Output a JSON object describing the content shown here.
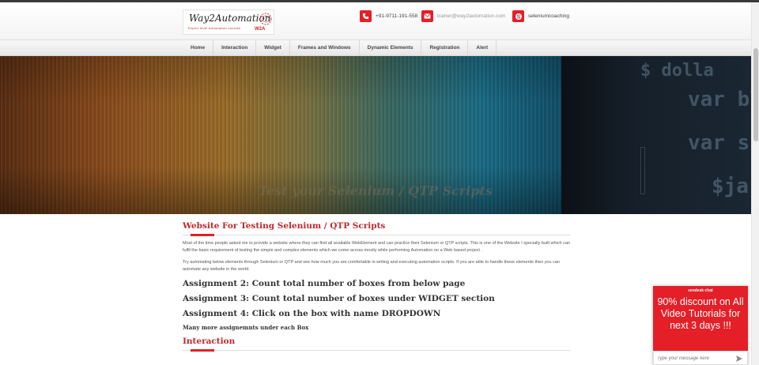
{
  "header": {
    "logo": {
      "name": "Way2Automation",
      "tagline": "Expert level Automation courses",
      "mark": "W2A"
    },
    "contacts": [
      {
        "icon": "phone-icon",
        "text": "+91-9711-191-558"
      },
      {
        "icon": "email-icon",
        "text": "trainer@way2automation.com"
      },
      {
        "icon": "skype-icon",
        "text": "seleniumcoaching"
      }
    ]
  },
  "nav": {
    "items": [
      "Home",
      "Interaction",
      "Widget",
      "Frames and Windows",
      "Dynamic Elements",
      "Registration",
      "Alert"
    ]
  },
  "hero": {
    "caption": "Test your Selenium / QTP Scripts",
    "code": [
      "$ dolla",
      "var bl",
      "var s",
      "$ja"
    ]
  },
  "main": {
    "heading": "Website For Testing Selenium / QTP Scripts",
    "paragraph1": "Most of the time people asked me to provide a website where they can find all available WebElement and can practice their Selenium or QTP scripts. This is one of the Website I specially built which can fulfil the basic requirement of testing the simple and complex elements which we come across mostly while performing Automation on a Web based project .",
    "paragraph2": "Try automating below elements through Selenium or QTP and see how much you are comfortable in writing and executing automation scripts. If you are able to handle these elements then you can automate any website in the world.",
    "assignments": [
      "Assignment 2: Count total number of boxes from below page",
      "Assignment 3: Count total number of boxes under WIDGET section",
      "Assignment 4: Click on the box with name DROPDOWN"
    ],
    "more": "Many more assignemnts under each Box",
    "section2": "Interaction"
  },
  "chat": {
    "header": "zendesk chat",
    "message": "90% discount on All Video Tutorials for next 3 days !!!",
    "placeholder": "Type your message here"
  },
  "colors": {
    "brand": "#e41f27",
    "heading": "#c0282d"
  }
}
